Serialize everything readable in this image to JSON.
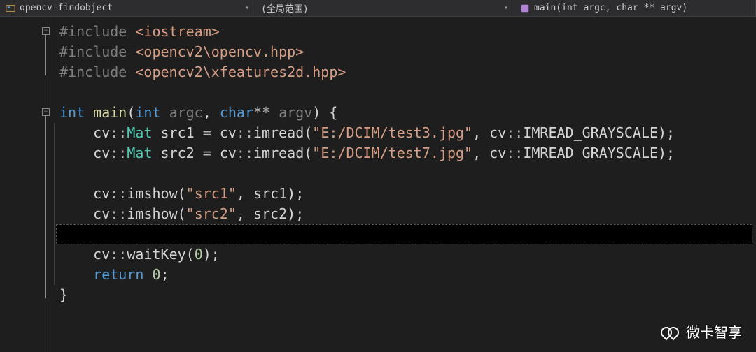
{
  "navbar": {
    "project": "opencv-findobject",
    "scope": "(全局范围)",
    "function": "main(int argc, char ** argv)"
  },
  "code": {
    "lines": [
      {
        "indent": 0,
        "tokens": [
          {
            "t": "#include ",
            "c": "inc-kw"
          },
          {
            "t": "<iostream>",
            "c": "angle"
          }
        ]
      },
      {
        "indent": 0,
        "tokens": [
          {
            "t": "#include ",
            "c": "inc-kw"
          },
          {
            "t": "<opencv2\\opencv.hpp>",
            "c": "angle"
          }
        ]
      },
      {
        "indent": 0,
        "tokens": [
          {
            "t": "#include ",
            "c": "inc-kw"
          },
          {
            "t": "<opencv2\\xfeatures2d.hpp>",
            "c": "angle"
          }
        ]
      },
      {
        "indent": 0,
        "tokens": []
      },
      {
        "indent": 0,
        "tokens": [
          {
            "t": "int",
            "c": "kw"
          },
          {
            "t": " ",
            "c": ""
          },
          {
            "t": "main",
            "c": "fn"
          },
          {
            "t": "(",
            "c": "punct"
          },
          {
            "t": "int",
            "c": "kw"
          },
          {
            "t": " ",
            "c": ""
          },
          {
            "t": "argc",
            "c": "param"
          },
          {
            "t": ", ",
            "c": "punct"
          },
          {
            "t": "char",
            "c": "kw"
          },
          {
            "t": "** ",
            "c": "op"
          },
          {
            "t": "argv",
            "c": "param"
          },
          {
            "t": ") {",
            "c": "punct"
          }
        ]
      },
      {
        "indent": 1,
        "tokens": [
          {
            "t": "cv",
            "c": ""
          },
          {
            "t": "::",
            "c": "op"
          },
          {
            "t": "Mat",
            "c": "type"
          },
          {
            "t": " src1 ",
            "c": ""
          },
          {
            "t": "=",
            "c": "op"
          },
          {
            "t": " cv",
            "c": ""
          },
          {
            "t": "::",
            "c": "op"
          },
          {
            "t": "imread",
            "c": ""
          },
          {
            "t": "(",
            "c": "punct"
          },
          {
            "t": "\"E:/DCIM/test3.jpg\"",
            "c": "str"
          },
          {
            "t": ", cv",
            "c": ""
          },
          {
            "t": "::",
            "c": "op"
          },
          {
            "t": "IMREAD_GRAYSCALE",
            "c": ""
          },
          {
            "t": ");",
            "c": "punct"
          }
        ]
      },
      {
        "indent": 1,
        "tokens": [
          {
            "t": "cv",
            "c": ""
          },
          {
            "t": "::",
            "c": "op"
          },
          {
            "t": "Mat",
            "c": "type"
          },
          {
            "t": " src2 ",
            "c": ""
          },
          {
            "t": "=",
            "c": "op"
          },
          {
            "t": " cv",
            "c": ""
          },
          {
            "t": "::",
            "c": "op"
          },
          {
            "t": "imread",
            "c": ""
          },
          {
            "t": "(",
            "c": "punct"
          },
          {
            "t": "\"E:/DCIM/test7.jpg\"",
            "c": "str"
          },
          {
            "t": ", cv",
            "c": ""
          },
          {
            "t": "::",
            "c": "op"
          },
          {
            "t": "IMREAD_GRAYSCALE",
            "c": ""
          },
          {
            "t": ");",
            "c": "punct"
          }
        ]
      },
      {
        "indent": 1,
        "tokens": []
      },
      {
        "indent": 1,
        "tokens": [
          {
            "t": "cv",
            "c": ""
          },
          {
            "t": "::",
            "c": "op"
          },
          {
            "t": "imshow",
            "c": ""
          },
          {
            "t": "(",
            "c": "punct"
          },
          {
            "t": "\"src1\"",
            "c": "str"
          },
          {
            "t": ", src1);",
            "c": "punct"
          }
        ]
      },
      {
        "indent": 1,
        "tokens": [
          {
            "t": "cv",
            "c": ""
          },
          {
            "t": "::",
            "c": "op"
          },
          {
            "t": "imshow",
            "c": ""
          },
          {
            "t": "(",
            "c": "punct"
          },
          {
            "t": "\"src2\"",
            "c": "str"
          },
          {
            "t": ", src2);",
            "c": "punct"
          }
        ]
      },
      {
        "indent": 1,
        "cursor": true,
        "tokens": []
      },
      {
        "indent": 1,
        "tokens": [
          {
            "t": "cv",
            "c": ""
          },
          {
            "t": "::",
            "c": "op"
          },
          {
            "t": "waitKey",
            "c": ""
          },
          {
            "t": "(",
            "c": "punct"
          },
          {
            "t": "0",
            "c": "num"
          },
          {
            "t": ");",
            "c": "punct"
          }
        ]
      },
      {
        "indent": 1,
        "tokens": [
          {
            "t": "return",
            "c": "kw2"
          },
          {
            "t": " ",
            "c": ""
          },
          {
            "t": "0",
            "c": "num"
          },
          {
            "t": ";",
            "c": "punct"
          }
        ]
      },
      {
        "indent": 0,
        "tokens": [
          {
            "t": "}",
            "c": "punct"
          }
        ]
      }
    ]
  },
  "folds": [
    {
      "line": 0,
      "symbol": "−"
    },
    {
      "line": 4,
      "symbol": "−"
    }
  ],
  "watermark": "微卡智享"
}
